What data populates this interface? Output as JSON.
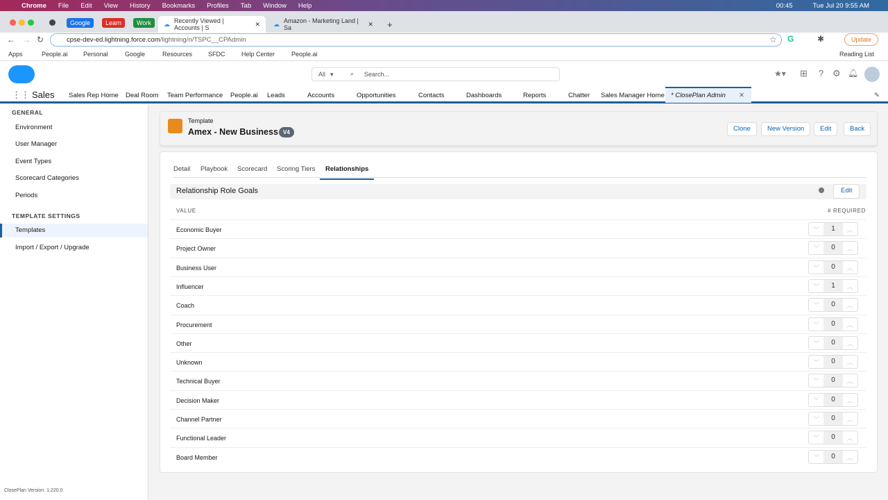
{
  "menubar": {
    "items": [
      "Chrome",
      "File",
      "Edit",
      "View",
      "History",
      "Bookmarks",
      "Profiles",
      "Tab",
      "Window",
      "Help"
    ],
    "timer": "00:45",
    "datetime": "Tue Jul 20  9:55 AM"
  },
  "browser": {
    "groups": [
      "Google",
      "Learn",
      "Work"
    ],
    "tabs": [
      "Recently Viewed | Accounts | S",
      "Amazon - Marketing Land | Sa"
    ],
    "url_host": "cpse-dev-ed.lightning.force.com",
    "url_path": "/lightning/n/TSPC__CPAdmin",
    "update": "Update",
    "bookmarks": [
      "Apps",
      "People.ai",
      "Personal",
      "Google",
      "Resources",
      "SFDC",
      "Help Center",
      "People.ai"
    ],
    "reading_list": "Reading List"
  },
  "sf": {
    "search_scope": "All",
    "search_placeholder": "Search...",
    "app": "Sales",
    "nav": [
      "Sales Rep Home",
      "Deal Room",
      "Team Performance",
      "People.ai",
      "Leads",
      "Accounts",
      "Opportunities",
      "Contacts",
      "Dashboards",
      "Reports",
      "Chatter",
      "Sales Manager Home"
    ],
    "active_tab": "* ClosePlan Admin"
  },
  "sidebar": {
    "general": "GENERAL",
    "general_items": [
      "Environment",
      "User Manager",
      "Event Types",
      "Scorecard Categories",
      "Periods"
    ],
    "template_settings": "TEMPLATE SETTINGS",
    "template_items": [
      "Templates",
      "Import / Export / Upgrade"
    ],
    "version": "ClosePlan Version: 1.220.0"
  },
  "header": {
    "kicker": "Template",
    "title": "Amex - New Business",
    "badge": "V4",
    "buttons": [
      "Clone",
      "New Version",
      "Edit",
      "Back"
    ]
  },
  "tabs": [
    "Detail",
    "Playbook",
    "Scorecard",
    "Scoring Tiers",
    "Relationships"
  ],
  "section": {
    "title": "Relationship Role Goals",
    "edit": "Edit",
    "col_value": "VALUE",
    "col_required": "# REQUIRED"
  },
  "rows": [
    {
      "label": "Economic Buyer",
      "value": "1"
    },
    {
      "label": "Project Owner",
      "value": "0"
    },
    {
      "label": "Business User",
      "value": "0"
    },
    {
      "label": "Influencer",
      "value": "1"
    },
    {
      "label": "Coach",
      "value": "0"
    },
    {
      "label": "Procurement",
      "value": "0"
    },
    {
      "label": "Other",
      "value": "0"
    },
    {
      "label": "Unknown",
      "value": "0"
    },
    {
      "label": "Technical Buyer",
      "value": "0"
    },
    {
      "label": "Decision Maker",
      "value": "0"
    },
    {
      "label": "Channel Partner",
      "value": "0"
    },
    {
      "label": "Functional Leader",
      "value": "0"
    },
    {
      "label": "Board Member",
      "value": "0"
    }
  ]
}
